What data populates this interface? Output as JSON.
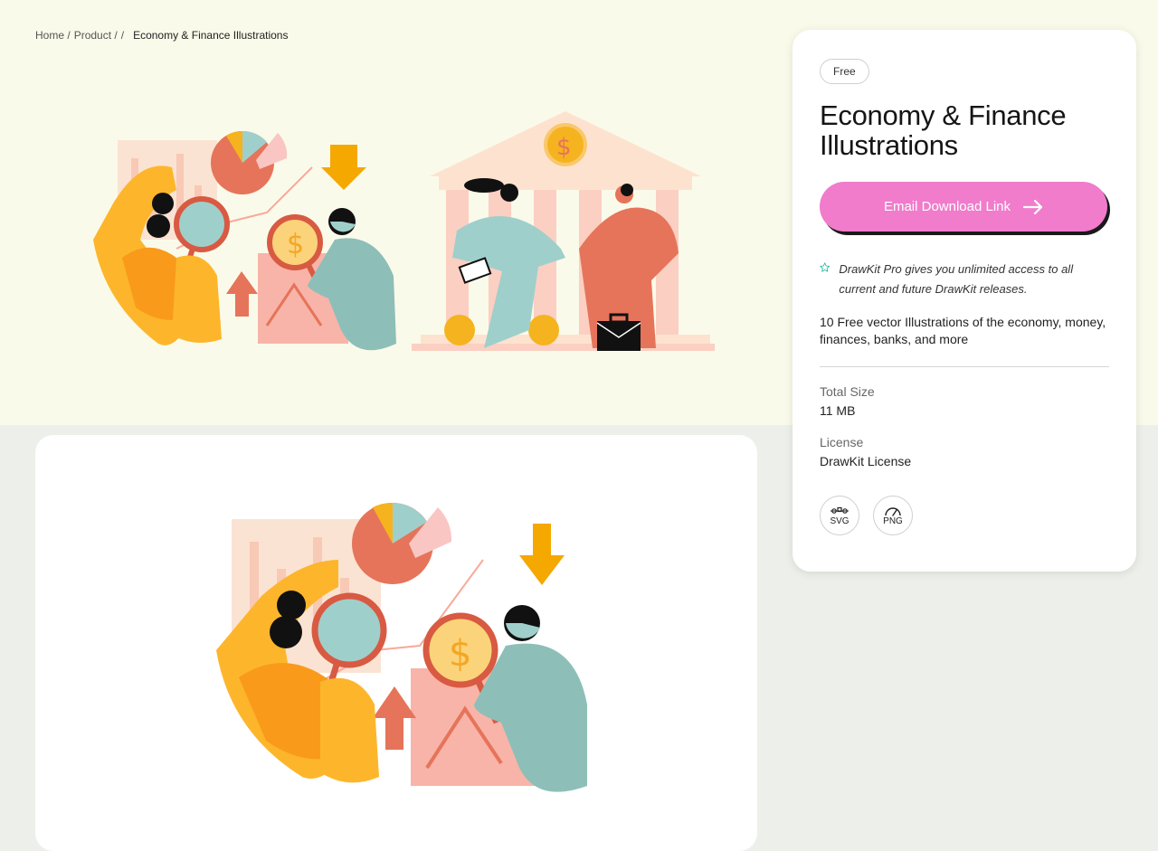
{
  "breadcrumb": {
    "home": "Home /",
    "product": "Product /",
    "separator": "/",
    "current": "Economy & Finance Illustrations"
  },
  "product": {
    "badge": "Free",
    "title": "Economy & Finance Illustrations",
    "cta_label": "Email Download Link",
    "pro_note": "DrawKit Pro gives you unlimited access to all current and future DrawKit releases.",
    "description": "10 Free vector Illustrations of the economy, money, finances, banks, and more",
    "total_size_label": "Total Size",
    "total_size_value": "11 MB",
    "license_label": "License",
    "license_value": "DrawKit License",
    "formats": [
      {
        "label": "SVG",
        "icon": "svg-format-icon"
      },
      {
        "label": "PNG",
        "icon": "png-format-icon"
      }
    ]
  },
  "colors": {
    "hero_bg": "#fafaea",
    "page_bg": "#edf0ea",
    "cta": "#f07ccb",
    "orange": "#f5a623",
    "teal": "#8fc2bd",
    "coral": "#e6745a",
    "pink": "#f8c3b7"
  }
}
